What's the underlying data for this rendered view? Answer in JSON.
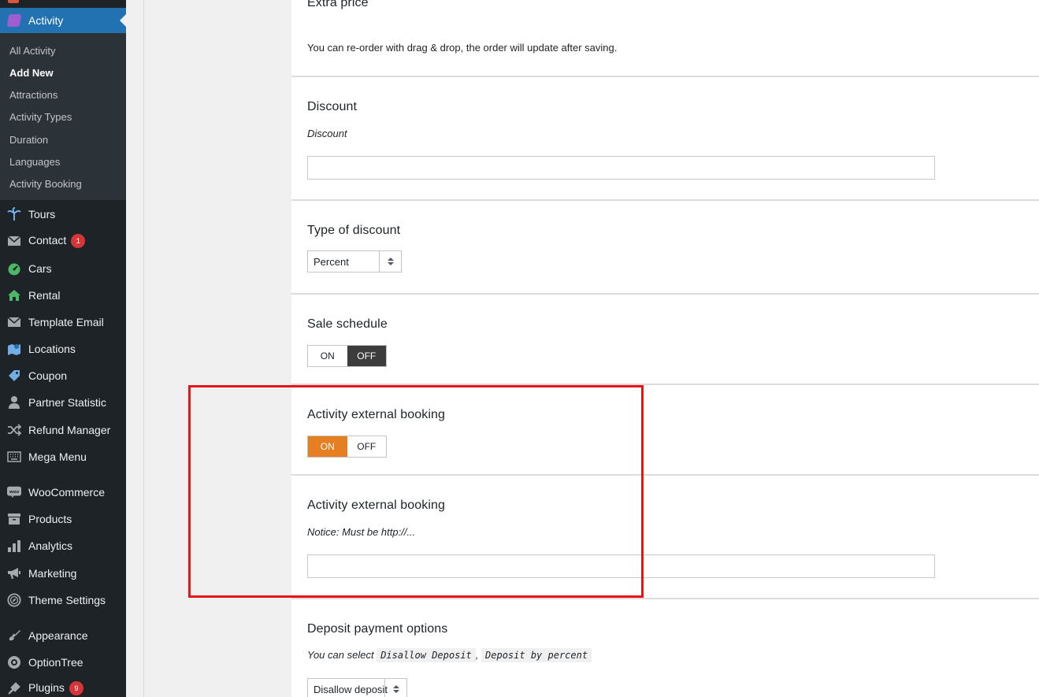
{
  "sidebar": {
    "active": {
      "label": "Activity",
      "icon": "activity-icon"
    },
    "submenu": [
      {
        "label": "All Activity"
      },
      {
        "label": "Add New",
        "current": true
      },
      {
        "label": "Attractions"
      },
      {
        "label": "Activity Types"
      },
      {
        "label": "Duration"
      },
      {
        "label": "Languages"
      },
      {
        "label": "Activity Booking"
      }
    ],
    "menu": [
      {
        "label": "Tours",
        "icon": "palm-tree-icon"
      },
      {
        "label": "Contact",
        "icon": "mail-icon",
        "badge": "1"
      },
      {
        "label": "Cars",
        "icon": "dashboard-icon"
      },
      {
        "label": "Rental",
        "icon": "house-icon"
      },
      {
        "label": "Template Email",
        "icon": "mail-icon"
      },
      {
        "label": "Locations",
        "icon": "map-icon"
      },
      {
        "label": "Coupon",
        "icon": "tag-icon"
      },
      {
        "label": "Partner Statistic",
        "icon": "user-icon"
      },
      {
        "label": "Refund Manager",
        "icon": "shuffle-icon"
      },
      {
        "label": "Mega Menu",
        "icon": "keyboard-icon"
      },
      {
        "label": "WooCommerce",
        "icon": "woo-icon"
      },
      {
        "label": "Products",
        "icon": "archive-icon"
      },
      {
        "label": "Analytics",
        "icon": "bar-chart-icon"
      },
      {
        "label": "Marketing",
        "icon": "megaphone-icon"
      },
      {
        "label": "Theme Settings",
        "icon": "compass-icon"
      },
      {
        "label": "Appearance",
        "icon": "paintbrush-icon"
      },
      {
        "label": "OptionTree",
        "icon": "option-tree-icon"
      },
      {
        "label": "Plugins",
        "icon": "plug-icon",
        "badge": "9"
      }
    ]
  },
  "form": {
    "extra_price": {
      "title": "Extra price",
      "desc": "You can re-order with drag & drop, the order will update after saving."
    },
    "discount": {
      "title": "Discount",
      "desc": "Discount",
      "value": ""
    },
    "type_of_discount": {
      "title": "Type of discount",
      "selected": "Percent"
    },
    "sale_schedule": {
      "title": "Sale schedule",
      "on": "ON",
      "off": "OFF",
      "state": "off"
    },
    "external_booking_toggle": {
      "title": "Activity external booking",
      "on": "ON",
      "off": "OFF",
      "state": "on"
    },
    "external_booking_url": {
      "title": "Activity external booking",
      "desc": "Notice: Must be http://...",
      "value": ""
    },
    "deposit": {
      "title": "Deposit payment options",
      "desc_prefix": "You can select",
      "code1": "Disallow Deposit",
      "sep": ",",
      "code2": "Deposit by percent",
      "selected": "Disallow deposit"
    }
  },
  "colors": {
    "accent": "#2271b1",
    "toggle_on": "#e67e22",
    "toggle_off_active": "#3c3c3c",
    "highlight": "#e8141a"
  }
}
